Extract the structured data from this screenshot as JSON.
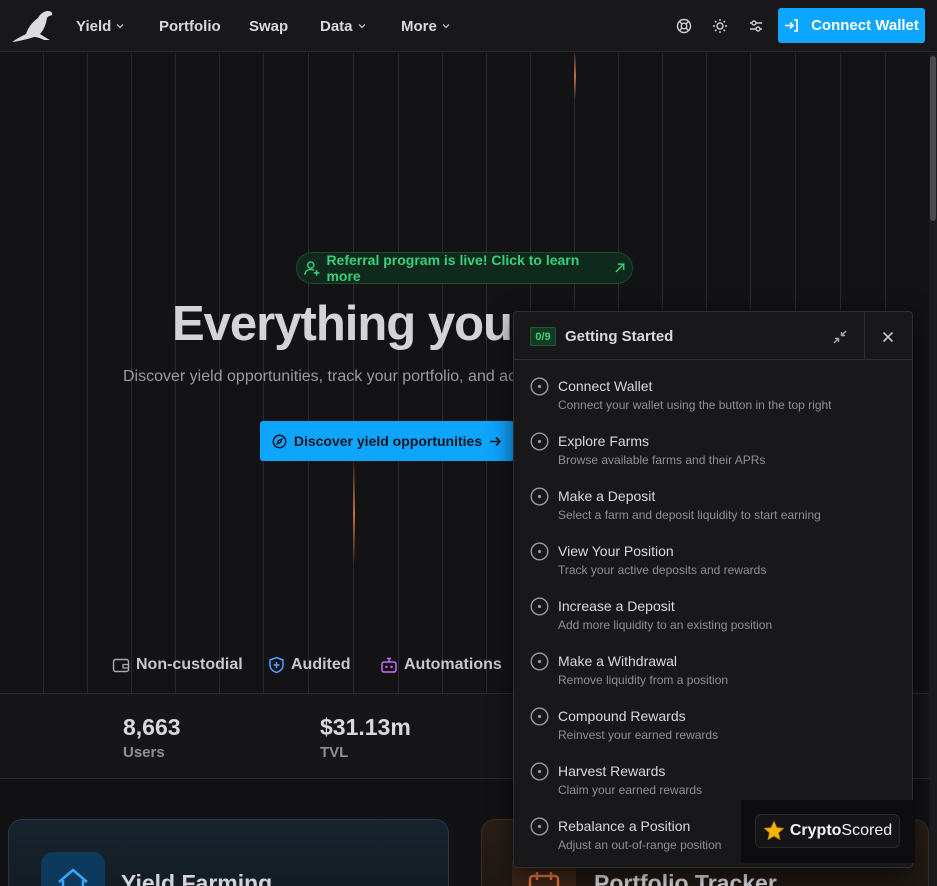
{
  "nav": {
    "items": [
      {
        "label": "Yield",
        "dropdown": true
      },
      {
        "label": "Portfolio",
        "dropdown": false
      },
      {
        "label": "Swap",
        "dropdown": false
      },
      {
        "label": "Data",
        "dropdown": true
      },
      {
        "label": "More",
        "dropdown": true
      }
    ],
    "icons": [
      "help-buoy-icon",
      "sun-icon",
      "settings-sliders-icon"
    ],
    "connect_label": "Connect Wallet"
  },
  "hero": {
    "referral": "Referral program is live! Click to learn more",
    "headline": "Everything you ne",
    "subline": "Discover yield opportunities, track your portfolio, and ac",
    "discover_label": "Discover yield opportunities",
    "features": [
      "Non-custodial",
      "Audited",
      "Automations"
    ]
  },
  "stats": [
    {
      "value": "8,663",
      "label": "Users"
    },
    {
      "value": "$31.13m",
      "label": "TVL"
    }
  ],
  "cards": [
    {
      "title": "Yield Farming",
      "accent": "#0ea5ff"
    },
    {
      "title": "Portfolio Tracker",
      "accent": "#e0703a"
    }
  ],
  "panel": {
    "progress": "0/9",
    "title": "Getting Started",
    "tasks": [
      {
        "title": "Connect Wallet",
        "desc": "Connect your wallet using the button in the top right"
      },
      {
        "title": "Explore Farms",
        "desc": "Browse available farms and their APRs"
      },
      {
        "title": "Make a Deposit",
        "desc": "Select a farm and deposit liquidity to start earning"
      },
      {
        "title": "View Your Position",
        "desc": "Track your active deposits and rewards"
      },
      {
        "title": "Increase a Deposit",
        "desc": "Add more liquidity to an existing position"
      },
      {
        "title": "Make a Withdrawal",
        "desc": "Remove liquidity from a position"
      },
      {
        "title": "Compound Rewards",
        "desc": "Reinvest your earned rewards"
      },
      {
        "title": "Harvest Rewards",
        "desc": "Claim your earned rewards"
      },
      {
        "title": "Rebalance a Position",
        "desc": "Adjust an out-of-range position"
      }
    ]
  },
  "badge": {
    "name_bold": "Crypto",
    "name_light": "Scored"
  },
  "colors": {
    "accent": "#0ea5ff",
    "success": "#34d27a",
    "background": "#121214"
  }
}
